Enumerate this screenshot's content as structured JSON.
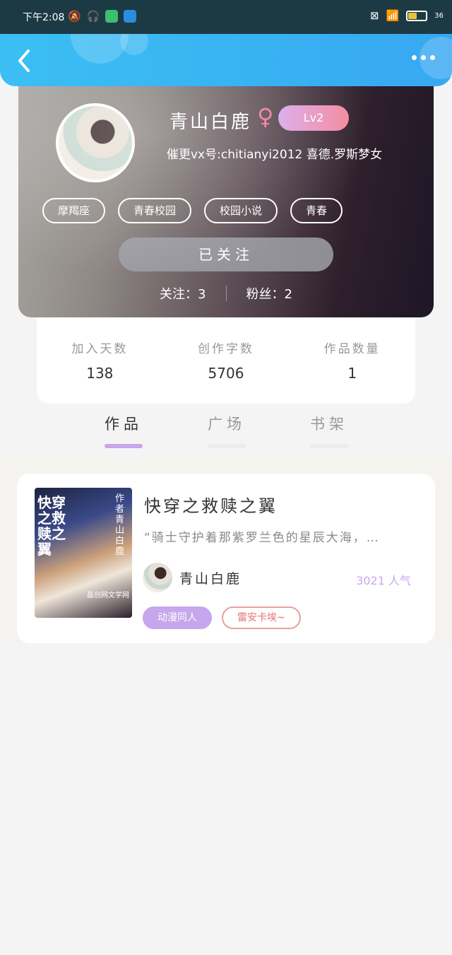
{
  "status_bar": {
    "time": "下午2:08",
    "battery": "36",
    "accent": "#1c3a44"
  },
  "nav": {
    "back_icon": "chevron-left-icon",
    "more_icon": "more-dots-icon",
    "gradient": [
      "#3bbff3",
      "#37a8f2"
    ]
  },
  "profile": {
    "username": "青山白鹿",
    "gender_symbol": "♀",
    "level": "Lv2",
    "bio": "催更vx号:chitianyi2012 喜德.罗斯梦女",
    "tags": [
      "摩羯座",
      "青春校园",
      "校园小说",
      "青春"
    ],
    "follow_button": "已关注",
    "following_label": "关注：",
    "following_count": "3",
    "fans_label": "粉丝：",
    "fans_count": "2"
  },
  "stats": [
    {
      "label": "加入天数",
      "value": "138"
    },
    {
      "label": "创作字数",
      "value": "5706"
    },
    {
      "label": "作品数量",
      "value": "1"
    }
  ],
  "tabs": [
    {
      "label": "作品",
      "active": true
    },
    {
      "label": "广场",
      "active": false
    },
    {
      "label": "书架",
      "active": false
    }
  ],
  "work": {
    "title": "快穿之救赎之翼",
    "excerpt": "“骑士守护着那紫罗兰色的星辰大海，…",
    "author": "青山白鹿",
    "popularity": "3021 人气",
    "tags": [
      "动漫同人",
      "雷安卡埃~"
    ],
    "cover": {
      "title": "快穿之救赎之翼",
      "author": "作者青山白鹿",
      "footer": "晶创网文学网"
    }
  },
  "colors": {
    "level_gradient": [
      "#d9a6ea",
      "#f58a9c"
    ],
    "tab_active_indicator": "#c8a6e9",
    "tag_filled": "#c6a6ec",
    "tag_outline": "#e57070"
  }
}
